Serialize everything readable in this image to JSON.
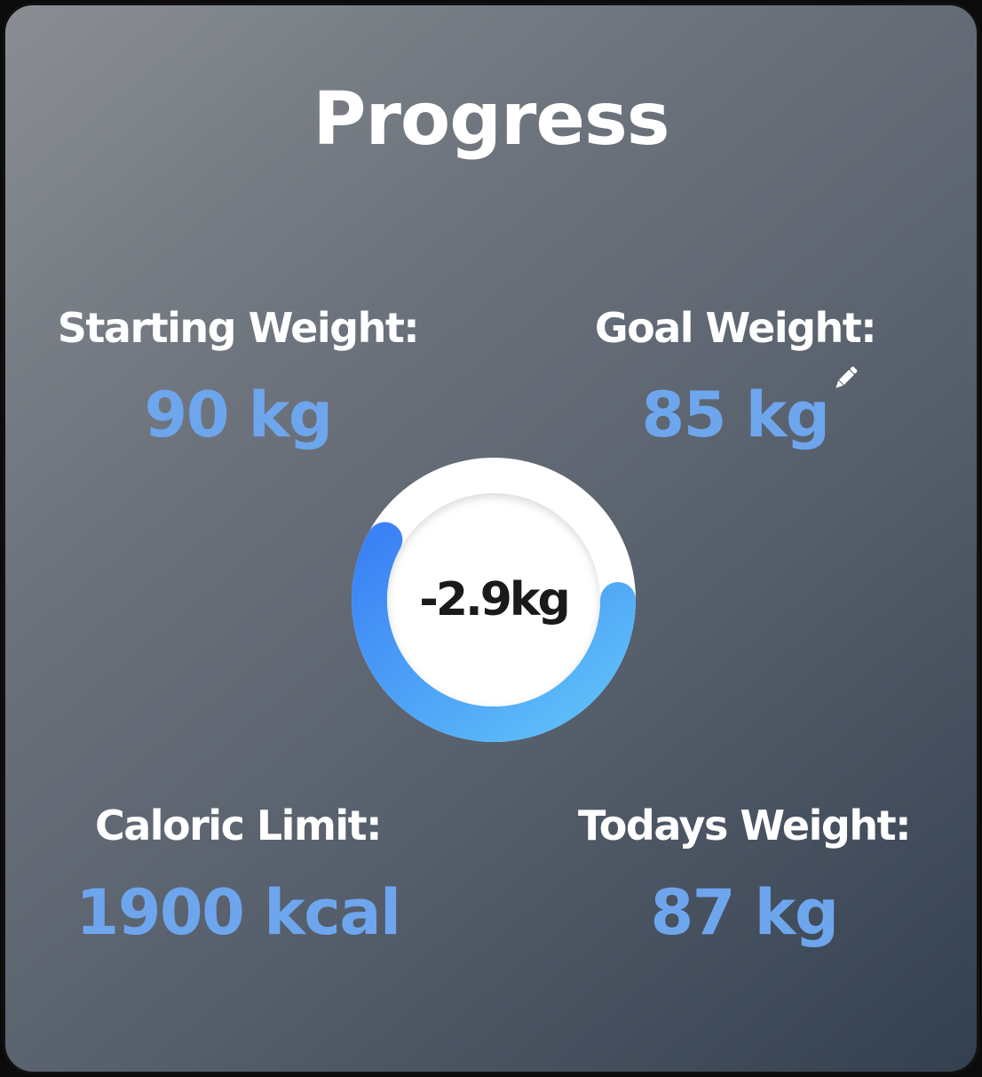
{
  "title": "Progress",
  "starting_weight": {
    "label": "Starting Weight:",
    "value": "90 kg"
  },
  "goal_weight": {
    "label": "Goal Weight:",
    "value": "85 kg",
    "edit_icon": "pencil-icon"
  },
  "caloric_limit": {
    "label": "Caloric Limit:",
    "value": "1900 kcal"
  },
  "todays_weight": {
    "label": "Todays Weight:",
    "value": "87 kg"
  },
  "progress_ring": {
    "center_text": "-2.9kg",
    "progress_fraction": 0.58,
    "gradient_start": "#3b82f6",
    "gradient_end": "#60c2f8"
  },
  "colors": {
    "value_accent": "#6ea6ee",
    "label": "#ffffff"
  }
}
